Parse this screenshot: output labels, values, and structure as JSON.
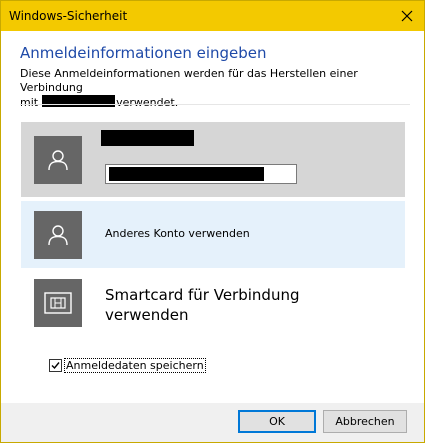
{
  "window": {
    "title": "Windows-Sicherheit",
    "accent_color": "#f3c900"
  },
  "dialog": {
    "heading": "Anmeldeinformationen eingeben",
    "description_line1": "Diese Anmeldeinformationen werden für das Herstellen einer Verbindung",
    "description_prefix": "mit",
    "description_suffix": "verwendet.",
    "heading_color": "#1f4aa8"
  },
  "accounts": {
    "selected": {
      "icon": "user-icon"
    },
    "other_account": {
      "label": "Anderes Konto verwenden",
      "icon": "user-icon"
    },
    "smartcard": {
      "label": "Smartcard für Verbindung verwenden",
      "icon": "smartcard-icon"
    }
  },
  "remember": {
    "label": "Anmeldedaten speichern",
    "checked": true
  },
  "buttons": {
    "ok": "OK",
    "cancel": "Abbrechen"
  }
}
